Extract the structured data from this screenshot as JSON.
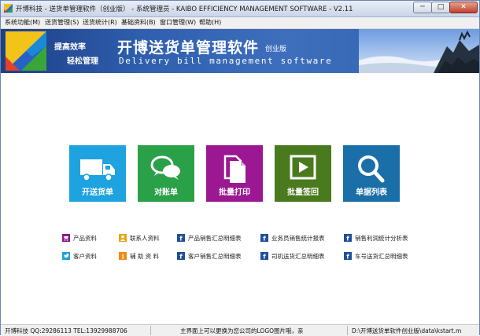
{
  "window": {
    "title": "开博科技 - 送货单管理软件（创业版） - 系统管理员 - KAIBO EFFICIENCY MANAGEMENT SOFTWARE - V2.11",
    "controls": {
      "minimize": "─",
      "maximize": "□",
      "close": "✕"
    }
  },
  "menu": [
    {
      "label": "系统功能(M)"
    },
    {
      "label": "送货管理(S)"
    },
    {
      "label": "送货统计(R)"
    },
    {
      "label": "基础资料(B)"
    },
    {
      "label": "窗口管理(W)"
    },
    {
      "label": "帮助(H)"
    }
  ],
  "banner": {
    "slogan_line1": "提高效率",
    "slogan_line2": "轻松管理",
    "title": "开博送货单管理软件",
    "edition": "创业版",
    "subtitle": "Delivery bill management software"
  },
  "tiles": [
    {
      "label": "开送货单",
      "icon": "truck-icon",
      "color": "#1ea2e0"
    },
    {
      "label": "对账单",
      "icon": "chat-icon",
      "color": "#2aa048"
    },
    {
      "label": "批量打印",
      "icon": "copy-document-icon",
      "color": "#9b1892"
    },
    {
      "label": "批量签回",
      "icon": "play-icon",
      "color": "#4a7a1e"
    },
    {
      "label": "单据列表",
      "icon": "search-icon",
      "color": "#1b6fa8"
    }
  ],
  "links_row1": [
    {
      "label": "产品资料",
      "icon": "cart-icon",
      "color": "#8a1a8a"
    },
    {
      "label": "联系人资料",
      "icon": "person-icon",
      "color": "#e8a21a"
    },
    {
      "label": "产品销售汇总明细表",
      "icon": "report-icon",
      "color": "#1f4f9a"
    },
    {
      "label": "业务员销售统计报表",
      "icon": "report-icon",
      "color": "#1f4f9a"
    },
    {
      "label": "销售利润统计分析表",
      "icon": "report-icon",
      "color": "#1f4f9a"
    }
  ],
  "links_row2": [
    {
      "label": "客户资料",
      "icon": "bird-icon",
      "color": "#1ea0e0"
    },
    {
      "label": "辅 助 资 料",
      "icon": "info-icon",
      "color": "#f08a10"
    },
    {
      "label": "客户销售汇总明细表",
      "icon": "report-icon",
      "color": "#1f4f9a"
    },
    {
      "label": "司机送货汇总明细表",
      "icon": "report-icon",
      "color": "#1f4f9a"
    },
    {
      "label": "车号送货汇总明细表",
      "icon": "report-icon",
      "color": "#1f4f9a"
    }
  ],
  "status": {
    "company": "开博科技 QQ:29286113 TEL:13929988706",
    "tip": "主界面上可以更换为您公司的LOGO图片哦，亲",
    "path": "D:\\开博送货单软件创业版\\data\\kstart.m"
  }
}
